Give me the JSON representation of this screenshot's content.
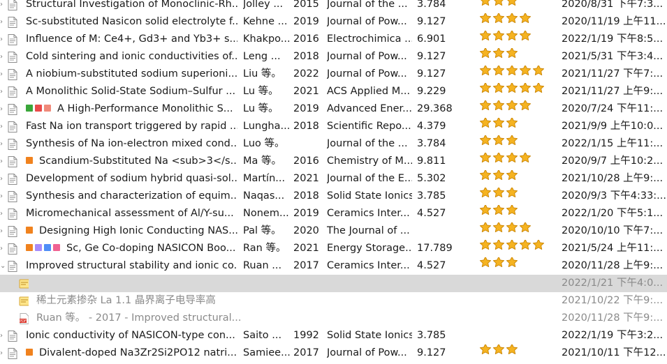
{
  "rows": [
    {
      "title": "Structural Investigation of Monoclinic-Rh...",
      "creator": "Jolley ...",
      "year": "2015",
      "publication": "Journal of the ...",
      "impact": "3.784",
      "rating": 3,
      "date": "2020/8/31 下午7:3...",
      "tags": [],
      "kind": "item",
      "twisty": "›"
    },
    {
      "title": "Sc-substituted Nasicon solid electrolyte f...",
      "creator": "Kehne ...",
      "year": "2019",
      "publication": "Journal of Pow...",
      "impact": "9.127",
      "rating": 4,
      "date": "2020/11/19 上午11...",
      "tags": [],
      "kind": "item",
      "twisty": "›"
    },
    {
      "title": "Influence of M: Ce4+, Gd3+ and Yb3+ s...",
      "creator": "Khakpo...",
      "year": "2016",
      "publication": "Electrochimica ...",
      "impact": "6.901",
      "rating": 4,
      "date": "2022/1/19 下午8:5...",
      "tags": [],
      "kind": "item",
      "twisty": "›"
    },
    {
      "title": "Cold sintering and ionic conductivities of...",
      "creator": "Leng ...",
      "year": "2018",
      "publication": "Journal of Pow...",
      "impact": "9.127",
      "rating": 3,
      "date": "2021/5/31 下午3:4...",
      "tags": [],
      "kind": "item",
      "twisty": "›"
    },
    {
      "title": "A niobium-substituted sodium superioni...",
      "creator": "Liu 等。",
      "year": "2022",
      "publication": "Journal of Pow...",
      "impact": "9.127",
      "rating": 5,
      "date": "2021/11/27 下午7:...",
      "tags": [],
      "kind": "item",
      "twisty": "›"
    },
    {
      "title": "A Monolithic Solid-State Sodium–Sulfur ...",
      "creator": "Lu 等。",
      "year": "2021",
      "publication": "ACS Applied M...",
      "impact": "9.229",
      "rating": 5,
      "date": "2021/11/27 上午9:...",
      "tags": [],
      "kind": "item",
      "twisty": "›"
    },
    {
      "title": "A High-Performance Monolithic S...",
      "creator": "Lu 等。",
      "year": "2019",
      "publication": "Advanced Ener...",
      "impact": "29.368",
      "rating": 4,
      "date": "2020/7/24 下午11:...",
      "tags": [
        "#3aa63a",
        "#e94b4b",
        "#f08a7a"
      ],
      "kind": "item",
      "twisty": "›"
    },
    {
      "title": "Fast Na ion transport triggered by rapid ...",
      "creator": "Lungha...",
      "year": "2018",
      "publication": "Scientific Repo...",
      "impact": "4.379",
      "rating": 3,
      "date": "2021/9/9 上午10:0...",
      "tags": [],
      "kind": "item",
      "twisty": "›"
    },
    {
      "title": "Synthesis of Na ion-electron mixed cond...",
      "creator": "Luo 等。",
      "year": "",
      "publication": "Journal of the ...",
      "impact": "3.784",
      "rating": 3,
      "date": "2022/1/15 上午11:...",
      "tags": [],
      "kind": "item",
      "twisty": "›"
    },
    {
      "title": "Scandium-Substituted Na <sub>3</s...",
      "creator": "Ma 等。",
      "year": "2016",
      "publication": "Chemistry of M...",
      "impact": "9.811",
      "rating": 4,
      "date": "2020/9/7 上午10:2...",
      "tags": [
        "#f0821e"
      ],
      "kind": "item",
      "twisty": "›"
    },
    {
      "title": "Development of sodium hybrid quasi-sol...",
      "creator": "Martín...",
      "year": "2021",
      "publication": "Journal of the E...",
      "impact": "5.302",
      "rating": 3,
      "date": "2021/10/28 上午9:...",
      "tags": [],
      "kind": "item",
      "twisty": "›"
    },
    {
      "title": "Synthesis and characterization of equim...",
      "creator": "Naqas...",
      "year": "2018",
      "publication": "Solid State Ionics",
      "impact": "3.785",
      "rating": 3,
      "date": "2020/9/3 下午4:33:...",
      "tags": [],
      "kind": "item",
      "twisty": "›"
    },
    {
      "title": "Micromechanical assessment of Al/Y-su...",
      "creator": "Nonem...",
      "year": "2019",
      "publication": "Ceramics Inter...",
      "impact": "4.527",
      "rating": 3,
      "date": "2022/1/20 下午5:1...",
      "tags": [],
      "kind": "item",
      "twisty": "›"
    },
    {
      "title": "Designing High Ionic Conducting NAS...",
      "creator": "Pal 等。",
      "year": "2020",
      "publication": "The Journal of ...",
      "impact": "",
      "rating": 4,
      "date": "2020/10/10 下午7:...",
      "tags": [
        "#f0821e"
      ],
      "kind": "item",
      "twisty": "›"
    },
    {
      "title": "Sc, Ge Co-doping NASICON Boo...",
      "creator": "Ran 等。",
      "year": "2021",
      "publication": "Energy Storage...",
      "impact": "17.789",
      "rating": 5,
      "date": "2021/5/24 上午11:...",
      "tags": [
        "#f0821e",
        "#a78bfa",
        "#4f8ef7",
        "#f06292"
      ],
      "kind": "item",
      "twisty": "›"
    },
    {
      "title": "Improved structural stability and ionic co...",
      "creator": "Ruan ...",
      "year": "2017",
      "publication": "Ceramics Inter...",
      "impact": "4.527",
      "rating": 3,
      "date": "2020/11/28 上午9:...",
      "tags": [],
      "kind": "item",
      "twisty": "⌄"
    },
    {
      "title": "",
      "creator": "",
      "year": "",
      "publication": "",
      "impact": "",
      "rating": 0,
      "date": "2022/1/21 下午4:0...",
      "tags": [],
      "kind": "note",
      "twisty": "",
      "selected": true
    },
    {
      "title": "稀土元素掺杂 La 1.1 晶界离子电导率高",
      "creator": "",
      "year": "",
      "publication": "",
      "impact": "",
      "rating": 0,
      "date": "2021/10/22 下午9:...",
      "tags": [],
      "kind": "note",
      "twisty": ""
    },
    {
      "title": "Ruan 等。 - 2017 - Improved structural...",
      "creator": "",
      "year": "",
      "publication": "",
      "impact": "",
      "rating": 0,
      "date": "2020/11/28 下午9:...",
      "tags": [],
      "kind": "pdf",
      "twisty": ""
    },
    {
      "title": "Ionic conductivity of NASICON-type con...",
      "creator": "Saito ...",
      "year": "1992",
      "publication": "Solid State Ionics",
      "impact": "3.785",
      "rating": 0,
      "date": "2022/1/19 下午3:2...",
      "tags": [],
      "kind": "item",
      "twisty": "›"
    },
    {
      "title": "Divalent-doped Na3Zr2Si2PO12 natri...",
      "creator": "Samiee...",
      "year": "2017",
      "publication": "Journal of Pow...",
      "impact": "9.127",
      "rating": 3,
      "date": "2021/10/11 下午12...",
      "tags": [
        "#f0821e"
      ],
      "kind": "item",
      "twisty": "›"
    }
  ]
}
